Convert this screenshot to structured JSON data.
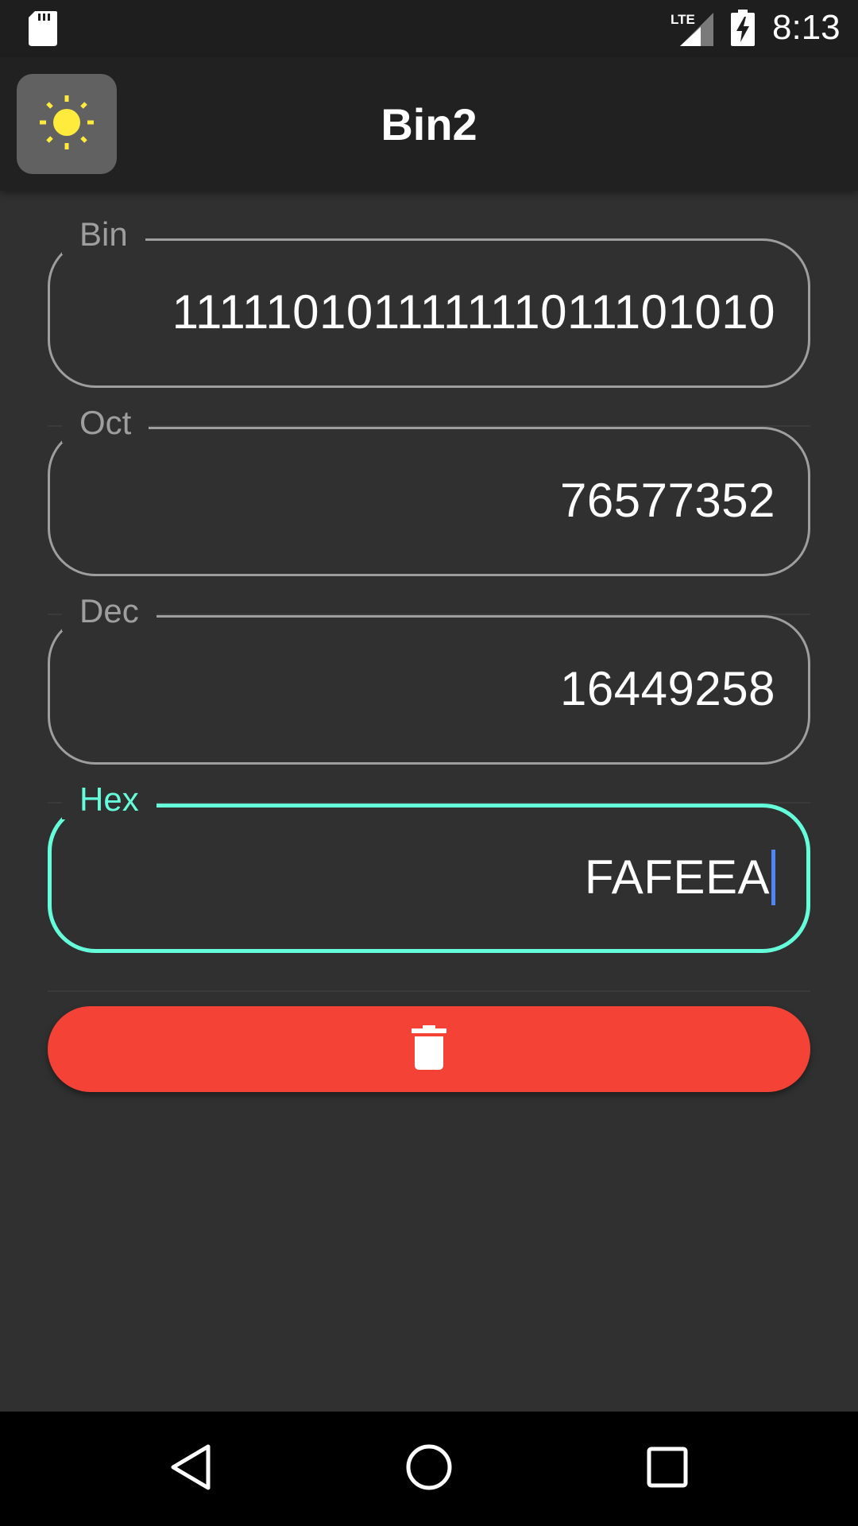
{
  "status_bar": {
    "time": "8:13",
    "icons": [
      "sd-card-icon",
      "lte-signal-icon",
      "battery-charging-icon"
    ],
    "network_label": "LTE"
  },
  "app_bar": {
    "title": "Bin2",
    "theme_icon": "sun-icon"
  },
  "fields": [
    {
      "label": "Bin",
      "value": "111110101111111011101010",
      "focused": false
    },
    {
      "label": "Oct",
      "value": "76577352",
      "focused": false
    },
    {
      "label": "Dec",
      "value": "16449258",
      "focused": false
    },
    {
      "label": "Hex",
      "value": "FAFEEA",
      "focused": true
    }
  ],
  "clear_button": {
    "icon": "trash-icon"
  },
  "nav_bar": {
    "icons": [
      "back-icon",
      "home-icon",
      "recents-icon"
    ]
  },
  "colors": {
    "background": "#303030",
    "app_bar": "#212121",
    "accent": "#64ffda",
    "outline": "#9e9e9e",
    "clear_button": "#f44336",
    "sun": "#ffeb3b",
    "cursor": "#4f86f7"
  }
}
